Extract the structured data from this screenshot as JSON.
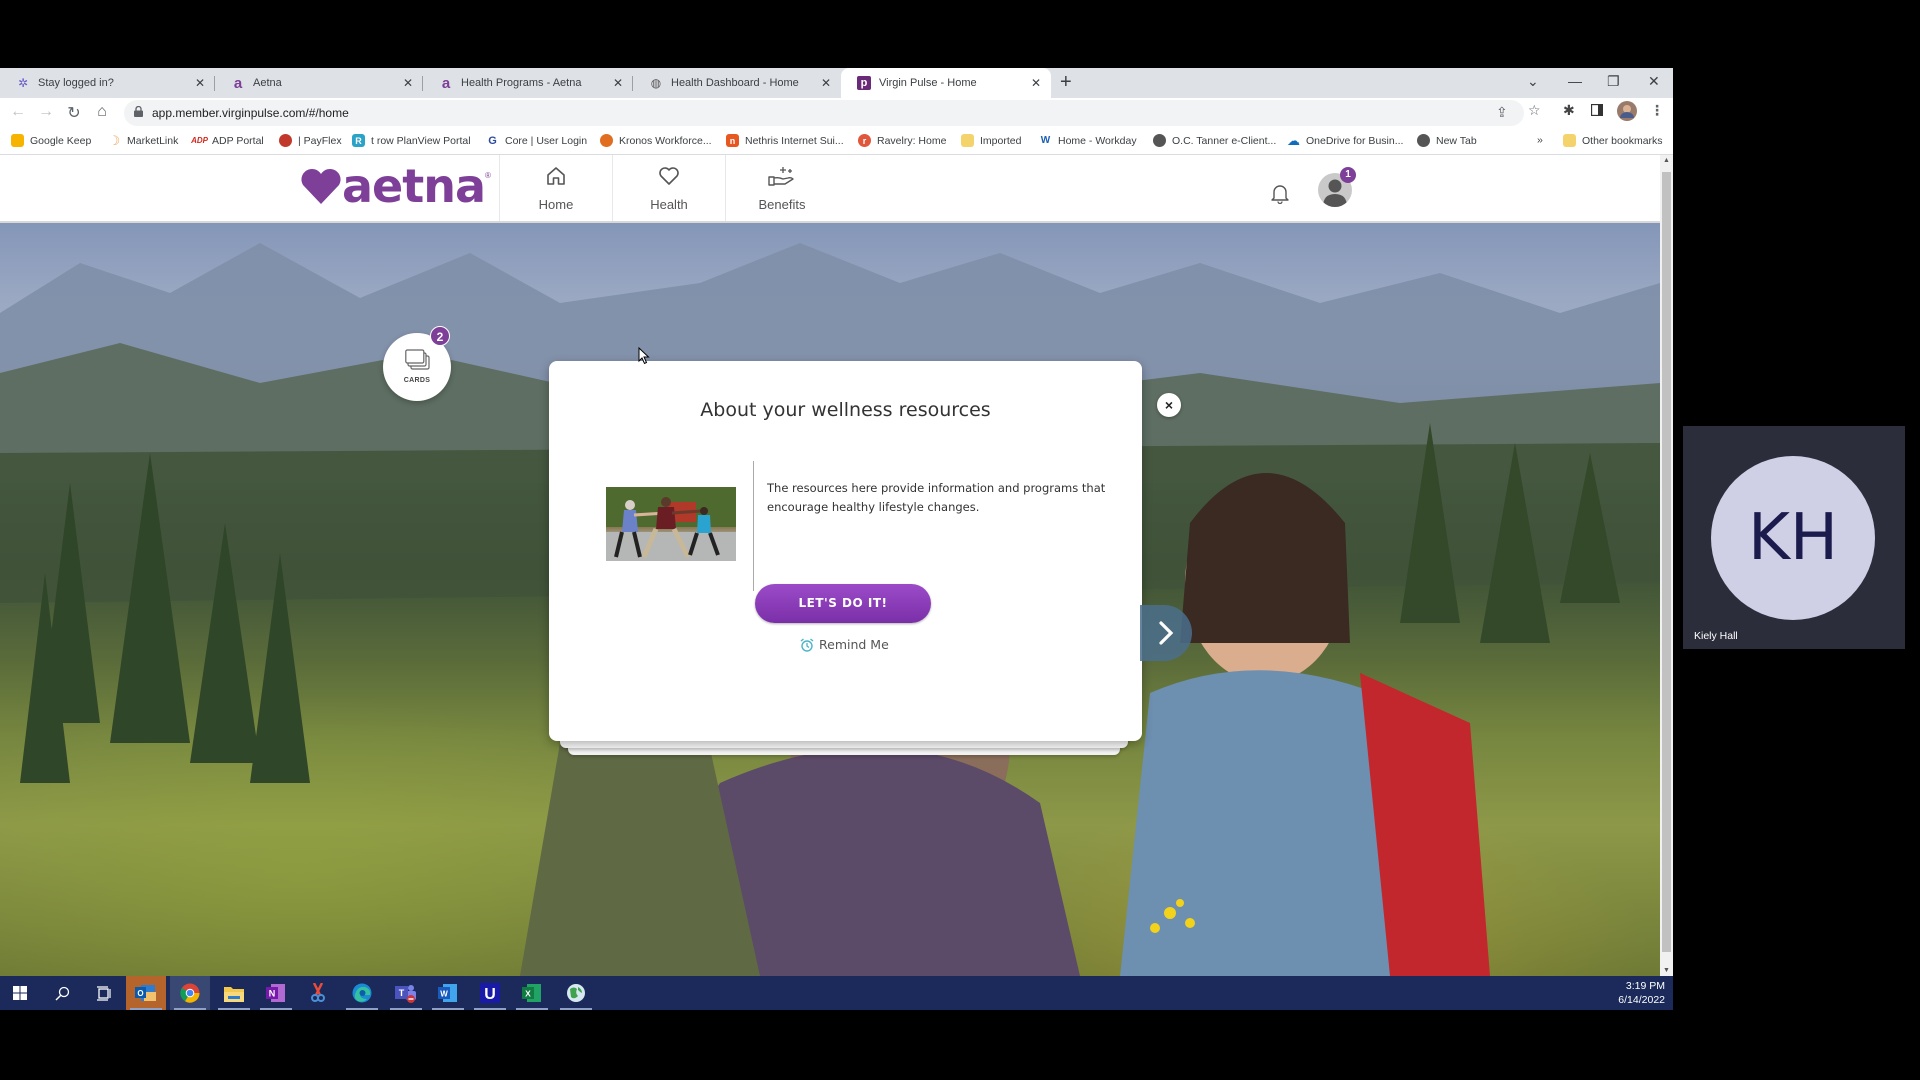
{
  "browser": {
    "tabs": [
      {
        "title": "Stay logged in?",
        "favicon": "star-logo-icon",
        "active": false
      },
      {
        "title": "Aetna",
        "favicon": "aetna-a-icon",
        "active": false
      },
      {
        "title": "Health Programs - Aetna",
        "favicon": "aetna-a-icon",
        "active": false
      },
      {
        "title": "Health Dashboard - Home",
        "favicon": "globe-icon",
        "active": false
      },
      {
        "title": "Virgin Pulse - Home",
        "favicon": "virgin-pulse-p-icon",
        "active": true
      }
    ],
    "new_tab_label": "+",
    "url": "app.member.virginpulse.com/#/home",
    "bookmarks": [
      {
        "label": "Google Keep",
        "icon": "google-keep-icon",
        "color": "#f6b400"
      },
      {
        "label": "MarketLink",
        "icon": "marketlink-icon",
        "color": "#f0a050"
      },
      {
        "label": "ADP Portal",
        "icon": "adp-icon",
        "color": "#d0271d"
      },
      {
        "label": "| PayFlex",
        "icon": "payflex-icon",
        "color": "#c0392b"
      },
      {
        "label": "t row PlanView Portal",
        "icon": "planview-icon",
        "color": "#2ba3c9"
      },
      {
        "label": "Core | User Login",
        "icon": "core-icon",
        "color": "#2d4b9e"
      },
      {
        "label": "Kronos Workforce...",
        "icon": "kronos-icon",
        "color": "#e06d20"
      },
      {
        "label": "Nethris Internet Sui...",
        "icon": "nethris-icon",
        "color": "#e8571f"
      },
      {
        "label": "Ravelry: Home",
        "icon": "ravelry-icon",
        "color": "#e0573b"
      },
      {
        "label": "Imported",
        "icon": "folder-icon",
        "color": "#f5d36c"
      },
      {
        "label": "Home - Workday",
        "icon": "workday-icon",
        "color": "#f0a400"
      },
      {
        "label": "O.C. Tanner e-Client...",
        "icon": "globe-icon",
        "color": "#555555"
      },
      {
        "label": "OneDrive for Busin...",
        "icon": "onedrive-icon",
        "color": "#0f6cbd"
      },
      {
        "label": "New Tab",
        "icon": "globe-icon",
        "color": "#555555"
      }
    ],
    "bookmarks_overflow": "»",
    "other_bookmarks": "Other bookmarks"
  },
  "app": {
    "brand": "aetna",
    "brand_color": "#7d3f98",
    "nav": [
      {
        "label": "Home",
        "icon": "home-icon"
      },
      {
        "label": "Health",
        "icon": "heart-icon"
      },
      {
        "label": "Benefits",
        "icon": "hand-sparkle-icon"
      }
    ],
    "profile_badge": "1",
    "cards": {
      "label": "CARDS",
      "badge": "2"
    }
  },
  "modal": {
    "title": "About your wellness resources",
    "description": "The resources here provide information and programs that encourage healthy lifestyle changes.",
    "cta_label": "LET'S DO IT!",
    "remind_label": "Remind Me",
    "close_label": "×"
  },
  "taskbar": {
    "apps": [
      "windows-start",
      "search",
      "task-view",
      "outlook",
      "chrome",
      "file-explorer",
      "onenote",
      "snipping-tool",
      "edge",
      "teams",
      "word",
      "u-app",
      "excel",
      "maps-globe"
    ],
    "time": "3:19 PM",
    "date": "6/14/2022"
  },
  "participant": {
    "initials": "KH",
    "name": "Kiely Hall"
  }
}
